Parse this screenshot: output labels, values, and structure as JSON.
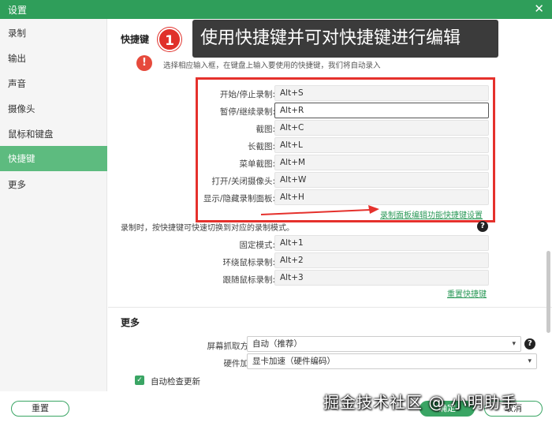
{
  "window": {
    "title": "设置",
    "close_glyph": "✕"
  },
  "sidebar": {
    "items": [
      {
        "label": "录制"
      },
      {
        "label": "输出"
      },
      {
        "label": "声音"
      },
      {
        "label": "摄像头"
      },
      {
        "label": "鼠标和键盘"
      },
      {
        "label": "快捷键",
        "active": true
      },
      {
        "label": "更多"
      }
    ]
  },
  "shortcuts": {
    "title": "快捷键",
    "warning_icon": "exclamation-icon",
    "warning_text": "选择相应输入框，在键盘上输入要使用的快捷键，我们将自动录入",
    "rows": [
      {
        "label": "开始/停止录制:",
        "value": "Alt+S"
      },
      {
        "label": "暂停/继续录制:",
        "value": "Alt+R"
      },
      {
        "label": "截图:",
        "value": "Alt+C"
      },
      {
        "label": "长截图:",
        "value": "Alt+L"
      },
      {
        "label": "菜单截图:",
        "value": "Alt+M"
      },
      {
        "label": "打开/关闭摄像头:",
        "value": "Alt+W"
      },
      {
        "label": "显示/隐藏录制面板:",
        "value": "Alt+H"
      }
    ],
    "panel_link": "录制面板编辑功能快捷键设置",
    "mode_hint": "录制时，按快捷键可快速切换到对应的录制模式。",
    "mode_rows": [
      {
        "label": "固定模式:",
        "value": "Alt+1"
      },
      {
        "label": "环绕鼠标录制:",
        "value": "Alt+2"
      },
      {
        "label": "跟随鼠标录制:",
        "value": "Alt+3"
      }
    ],
    "reset_link": "重置快捷键"
  },
  "callout": {
    "number": "1",
    "text": "使用快捷键并可对快捷键进行编辑"
  },
  "more": {
    "title": "更多",
    "capture_label": "屏幕抓取方式:",
    "capture_value": "自动（推荐）",
    "hw_label": "硬件加速:",
    "hw_value": "显卡加速（硬件编码）",
    "auto_update_label": "自动检查更新",
    "auto_update_checked": true
  },
  "footer": {
    "reset": "重置",
    "ok": "确定",
    "cancel": "取消"
  },
  "watermark": "掘金技术社区 @ 小明助手",
  "colors": {
    "accent": "#3aa564",
    "active_nav": "#5dbb7f",
    "annotation_red": "#e5312c"
  }
}
